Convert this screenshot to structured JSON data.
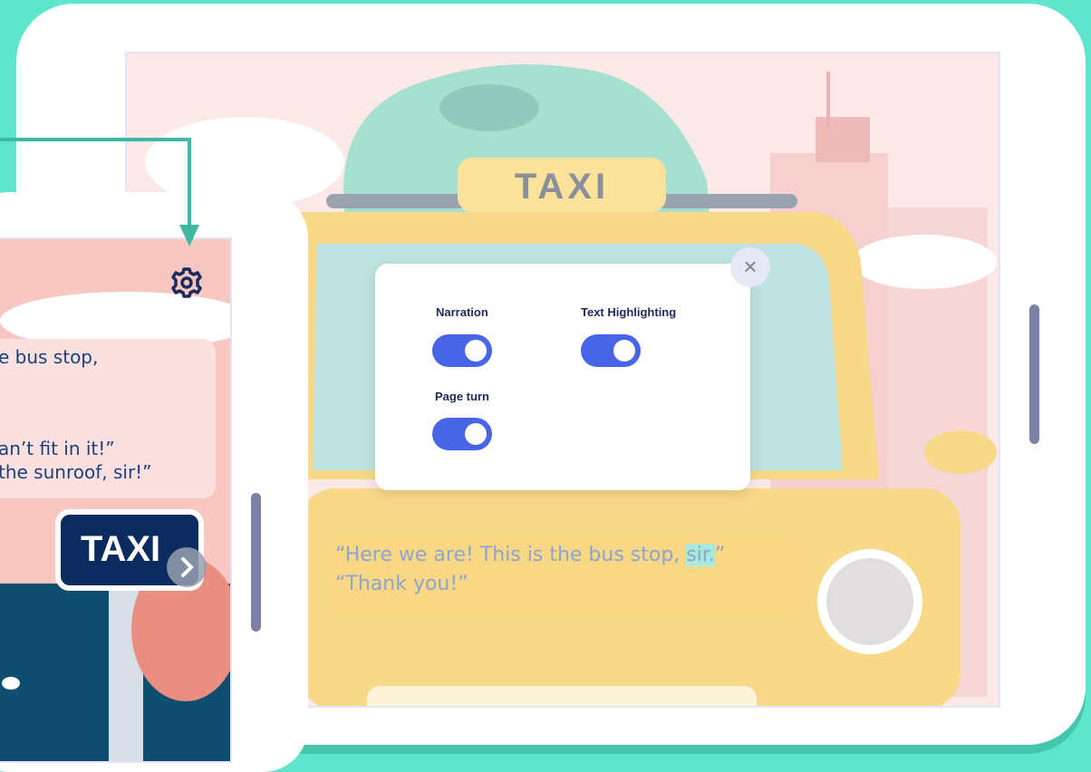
{
  "dialog": {
    "close_glyph": "×",
    "narration_label": "Narration",
    "text_highlighting_label": "Text Highlighting",
    "page_turn_label": "Page turn",
    "narration_on": true,
    "text_highlighting_on": true,
    "page_turn_on": true
  },
  "scene": {
    "taxi_sign": "TAXI"
  },
  "story_right": {
    "line1_before": "“Here we are! This is the bus stop, ",
    "line1_highlight": "sir.",
    "line1_after": "”",
    "line2": "“Thank you!”"
  },
  "story_left": {
    "line1": "e bus stop,",
    "line2": "an’t fit in it!”",
    "line3": " the sunroof, sir!”"
  },
  "left_screen": {
    "taxi_sign": "TAXI",
    "settings_icon": "gear-icon",
    "next_icon": "chevron-right-icon"
  },
  "colors": {
    "background": "#5ee6cc",
    "toggle_on": "#4865e8",
    "highlight": "#a7e8df",
    "label": "#1c2a5c"
  }
}
